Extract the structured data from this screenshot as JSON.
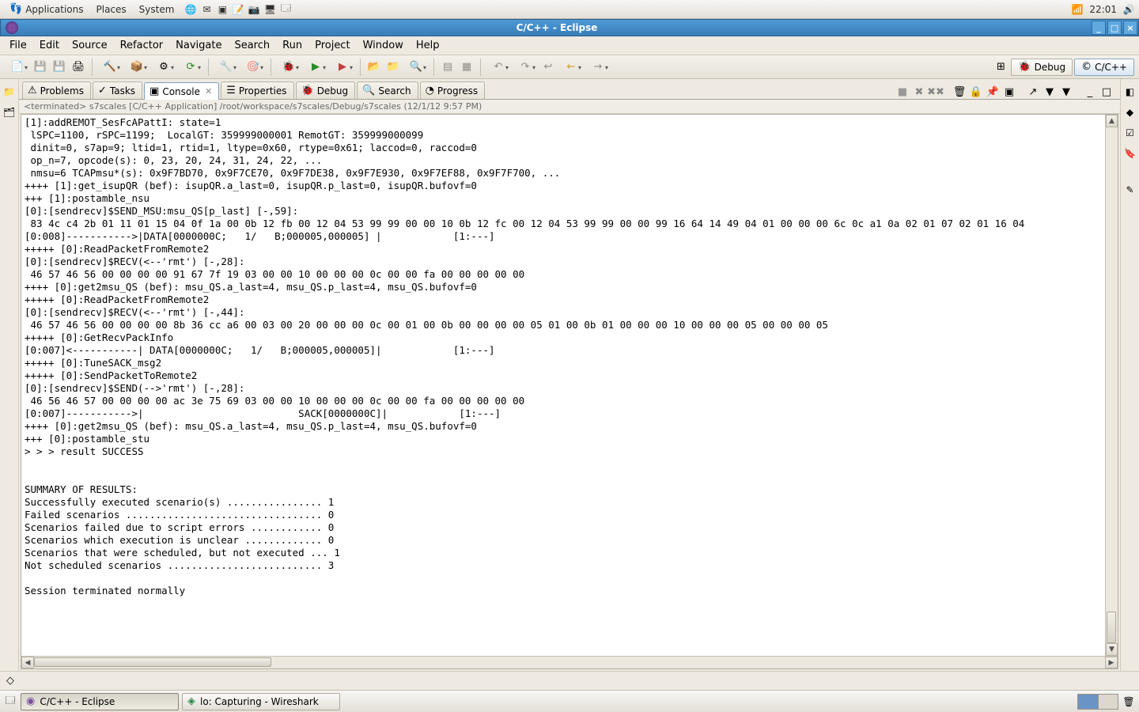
{
  "gnome": {
    "apps": "Applications",
    "places": "Places",
    "system": "System",
    "time": "22:01"
  },
  "titlebar": {
    "title": "C/C++ - Eclipse"
  },
  "menubar": {
    "file": "File",
    "edit": "Edit",
    "source": "Source",
    "refactor": "Refactor",
    "navigate": "Navigate",
    "search": "Search",
    "run": "Run",
    "project": "Project",
    "window": "Window",
    "help": "Help"
  },
  "perspectives": {
    "debug": "Debug",
    "cpp": "C/C++"
  },
  "tabs": {
    "problems": "Problems",
    "tasks": "Tasks",
    "console": "Console",
    "properties": "Properties",
    "debug": "Debug",
    "search": "Search",
    "progress": "Progress"
  },
  "console_header": "<terminated> s7scales [C/C++ Application] /root/workspace/s7scales/Debug/s7scales (12/1/12 9:57 PM)",
  "console_lines": [
    "[1]:addREMOT_SesFcAPattI: state=1",
    " lSPC=1100, rSPC=1199;  LocalGT: 359999000001 RemotGT: 359999000099",
    " dinit=0, s7ap=9; ltid=1, rtid=1, ltype=0x60, rtype=0x61; laccod=0, raccod=0",
    " op_n=7, opcode(s): 0, 23, 20, 24, 31, 24, 22, ...",
    " nmsu=6 TCAPmsu*(s): 0x9F7BD70, 0x9F7CE70, 0x9F7DE38, 0x9F7E930, 0x9F7EF88, 0x9F7F700, ...",
    "++++ [1]:get_isupQR (bef): isupQR.a_last=0, isupQR.p_last=0, isupQR.bufovf=0",
    "+++ [1]:postamble_nsu",
    "[0]:[sendrecv]$SEND_MSU:msu_QS[p_last] [-,59]:",
    " 83 4c c4 2b 01 11 01 15 04 0f 1a 00 0b 12 fb 00 12 04 53 99 99 00 00 10 0b 12 fc 00 12 04 53 99 99 00 00 99 16 64 14 49 04 01 00 00 00 6c 0c a1 0a 02 01 07 02 01 16 04",
    "[0:008]----------->|DATA[0000000C;   1/   B;000005,000005] |            [1:---]",
    "+++++ [0]:ReadPacketFromRemote2",
    "[0]:[sendrecv]$RECV(<--'rmt') [-,28]:",
    " 46 57 46 56 00 00 00 00 91 67 7f 19 03 00 00 10 00 00 00 0c 00 00 fa 00 00 00 00 00",
    "++++ [0]:get2msu_QS (bef): msu_QS.a_last=4, msu_QS.p_last=4, msu_QS.bufovf=0",
    "+++++ [0]:ReadPacketFromRemote2",
    "[0]:[sendrecv]$RECV(<--'rmt') [-,44]:",
    " 46 57 46 56 00 00 00 00 8b 36 cc a6 00 03 00 20 00 00 00 0c 00 01 00 0b 00 00 00 00 05 01 00 0b 01 00 00 00 10 00 00 00 05 00 00 00 05",
    "+++++ [0]:GetRecvPackInfo",
    "[0:007]<-----------| DATA[0000000C;   1/   B;000005,000005]|            [1:---]",
    "+++++ [0]:TuneSACK_msg2",
    "+++++ [0]:SendPacketToRemote2",
    "[0]:[sendrecv]$SEND(-->'rmt') [-,28]:",
    " 46 56 46 57 00 00 00 00 ac 3e 75 69 03 00 00 10 00 00 00 0c 00 00 fa 00 00 00 00 00",
    "[0:007]----------->|                          SACK[0000000C]|            [1:---]",
    "++++ [0]:get2msu_QS (bef): msu_QS.a_last=4, msu_QS.p_last=4, msu_QS.bufovf=0",
    "+++ [0]:postamble_stu",
    "> > > result SUCCESS",
    "",
    "",
    "SUMMARY OF RESULTS:",
    "Successfully executed scenario(s) ................ 1",
    "Failed scenarios ................................. 0",
    "Scenarios failed due to script errors ............ 0",
    "Scenarios which execution is unclear ............. 0",
    "Scenarios that were scheduled, but not executed ... 1",
    "Not scheduled scenarios .......................... 3",
    "",
    "Session terminated normally"
  ],
  "taskbar": {
    "eclipse": "C/C++ - Eclipse",
    "wireshark": "lo: Capturing - Wireshark"
  }
}
